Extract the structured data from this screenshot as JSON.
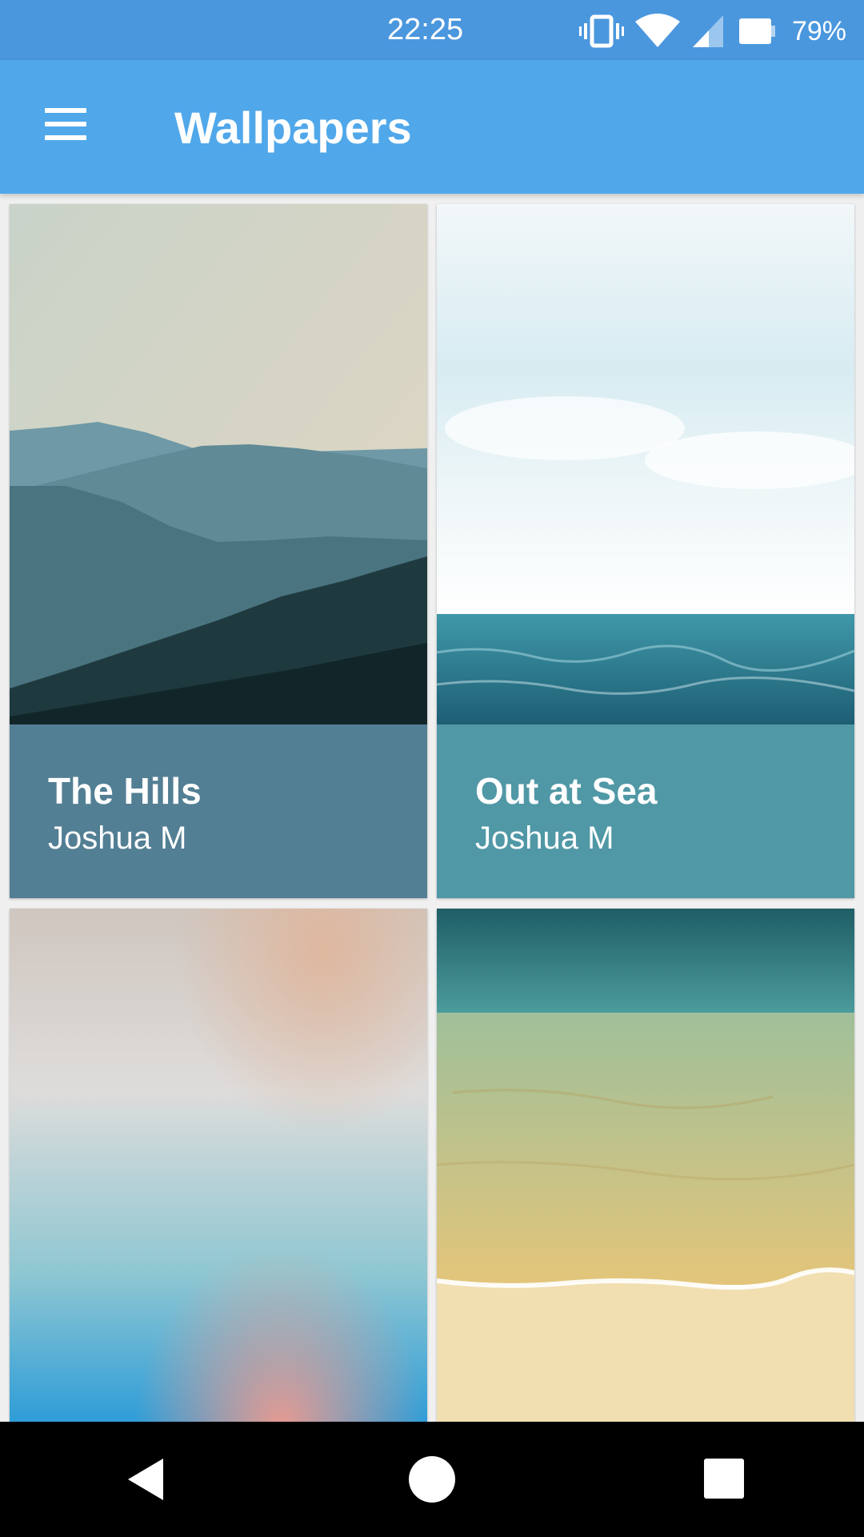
{
  "status_bar": {
    "time": "22:25",
    "battery": "79%",
    "icons": [
      "vibrate-icon",
      "wifi-icon",
      "cell-signal-icon",
      "battery-icon"
    ]
  },
  "app_bar": {
    "title": "Wallpapers",
    "menu_icon": "menu-icon",
    "color": "#50a8ea"
  },
  "wallpapers": [
    {
      "title": "The Hills",
      "author": "Joshua M",
      "footer_color": "#537f94"
    },
    {
      "title": "Out at Sea",
      "author": "Joshua M",
      "footer_color": "#5098a6"
    },
    {
      "title": "",
      "author": "",
      "footer_color": ""
    },
    {
      "title": "",
      "author": "",
      "footer_color": ""
    }
  ],
  "nav_bar": {
    "buttons": [
      "back-icon",
      "home-icon",
      "recents-icon"
    ]
  }
}
